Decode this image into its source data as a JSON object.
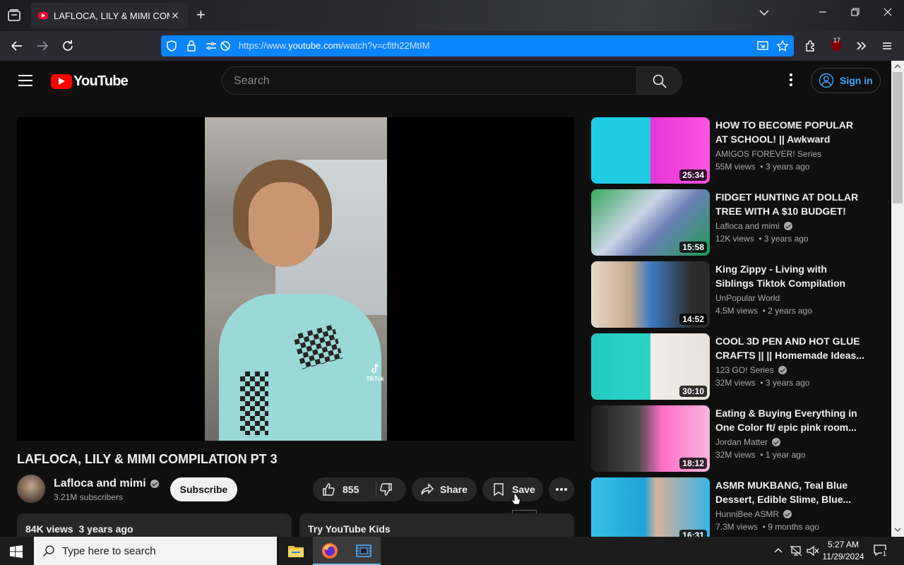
{
  "browser": {
    "tab_title": "LAFLOCA, LILY & MIMI COMPILATION PT 3",
    "url_prefix": "https://www.",
    "url_domain": "youtube.com",
    "url_path": "/watch?v=cflth22MtIM",
    "extension_badge": "17"
  },
  "header": {
    "logo_text": "YouTube",
    "search_placeholder": "Search",
    "signin_label": "Sign in"
  },
  "video": {
    "title": "LAFLOCA, LILY & MIMI COMPILATION PT 3",
    "channel": "Lafloca and mimi",
    "subscribers": "3.21M subscribers",
    "subscribe_label": "Subscribe",
    "likes": "855",
    "share_label": "Share",
    "save_label": "Save",
    "tooltip": "Save",
    "watermark": "TikTok",
    "views_line": "84K views  3 years ago",
    "kids_line": "Try YouTube Kids"
  },
  "recommendations": [
    {
      "title": "HOW TO BECOME POPULAR AT SCHOOL! || Awkward School...",
      "channel": "AMIGOS FOREVER! Series",
      "verified": false,
      "meta": "55M views  • 3 years ago",
      "duration": "25:34"
    },
    {
      "title": "FIDGET HUNTING AT DOLLAR TREE WITH A $10 BUDGET!",
      "channel": "Lafloca and mimi",
      "verified": true,
      "meta": "12K views  • 3 years ago",
      "duration": "15:58"
    },
    {
      "title": "King Zippy - Living with Siblings Tiktok Compilation",
      "channel": "UnPopular World",
      "verified": false,
      "meta": "4.5M views  • 2 years ago",
      "duration": "14:52"
    },
    {
      "title": "COOL 3D PEN AND HOT GLUE CRAFTS || || Homemade Ideas...",
      "channel": "123 GO! Series",
      "verified": true,
      "meta": "32M views  • 3 years ago",
      "duration": "30:10"
    },
    {
      "title": "Eating & Buying Everything in One Color ft/ epic pink room...",
      "channel": "Jordan Matter",
      "verified": true,
      "meta": "32M views  • 1 year ago",
      "duration": "18:12"
    },
    {
      "title": "ASMR MUKBANG, Teal Blue Dessert, Edible Slime, Blue...",
      "channel": "HunniBee ASMR",
      "verified": true,
      "meta": "7.3M views  • 9 months ago",
      "duration": "16:31"
    }
  ],
  "taskbar": {
    "search_placeholder": "Type here to search",
    "time": "5:27 AM",
    "date": "11/29/2024",
    "notification_count": "1"
  },
  "colors": {
    "youtube_red": "#ff0000",
    "url_highlight": "#0a84ff",
    "background": "#0f0f0f"
  }
}
